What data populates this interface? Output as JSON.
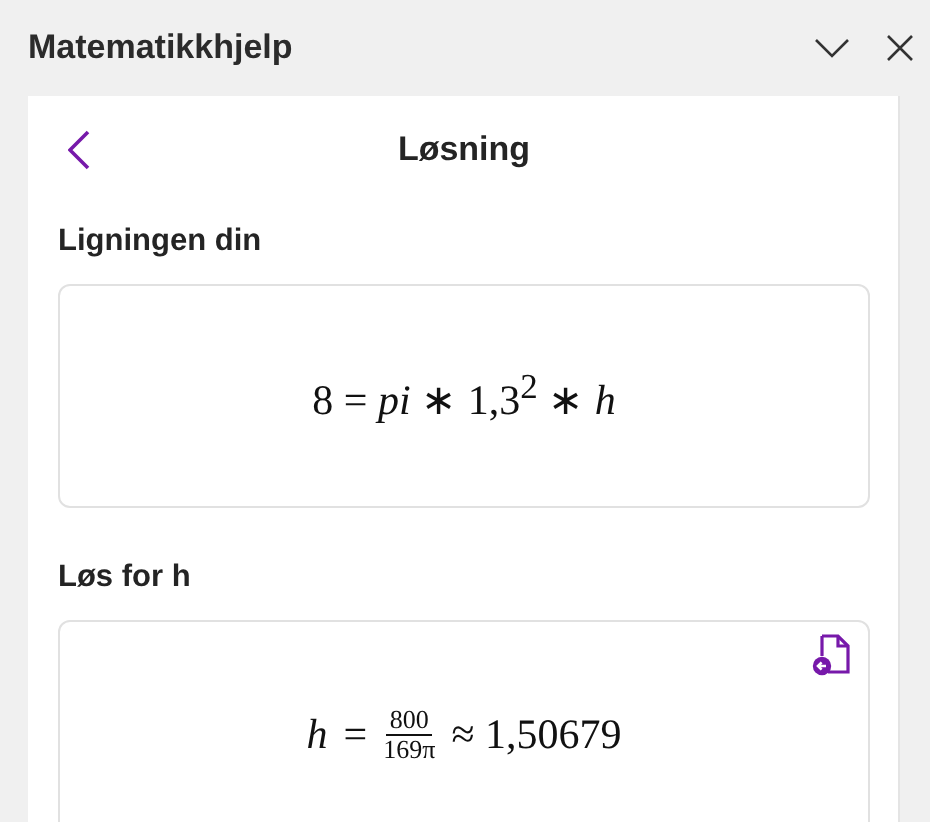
{
  "window": {
    "title": "Matematikkhjelp"
  },
  "header": {
    "title": "Løsning"
  },
  "sections": [
    {
      "label": "Ligningen din",
      "kind": "equation",
      "expression": "8 = *pi* ∗ 1,3$^{2}$ ∗ *h*"
    },
    {
      "label": "Løs for h",
      "kind": "solution",
      "lhs": "h",
      "relation": "=",
      "numerator": "800",
      "denominator": "169π",
      "result": "≈ 1,50679"
    }
  ]
}
